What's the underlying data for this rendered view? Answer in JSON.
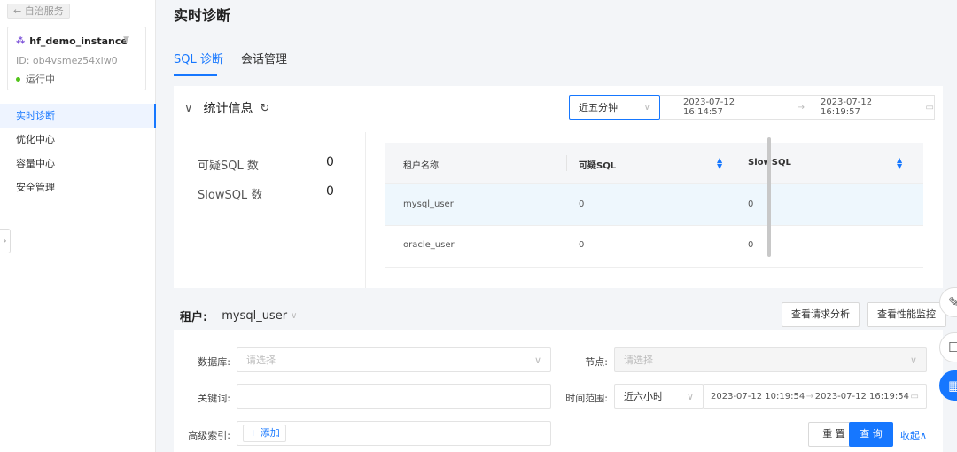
{
  "sidebar": {
    "back_label": "← 自治服务",
    "instance": {
      "name": "hf_demo_instance",
      "id": "ID: ob4vsmez54xiw0",
      "status": "运行中"
    },
    "menu": [
      {
        "label": "实时诊断",
        "active": true
      },
      {
        "label": "优化中心",
        "active": false
      },
      {
        "label": "容量中心",
        "active": false
      },
      {
        "label": "安全管理",
        "active": false
      }
    ]
  },
  "page": {
    "title": "实时诊断"
  },
  "tabs": [
    {
      "label": "SQL 诊断",
      "active": true
    },
    {
      "label": "会话管理",
      "active": false
    }
  ],
  "stats": {
    "title": "统计信息",
    "time_select": "近五分钟",
    "range_from": "2023-07-12 16:14:57",
    "range_to": "2023-07-12 16:19:57",
    "items": [
      {
        "label": "可疑SQL 数",
        "value": "0"
      },
      {
        "label": "SlowSQL 数",
        "value": "0"
      }
    ],
    "table": {
      "headers": [
        "租户名称",
        "可疑SQL",
        "SlowSQL"
      ],
      "rows": [
        {
          "tenant": "mysql_user",
          "suspicious": "0",
          "slow": "0"
        },
        {
          "tenant": "oracle_user",
          "suspicious": "0",
          "slow": "0"
        }
      ]
    }
  },
  "tenant_bar": {
    "label": "租户:",
    "value": "mysql_user",
    "request_btn": "查看请求分析",
    "perf_btn": "查看性能监控"
  },
  "filters": {
    "db_label": "数据库:",
    "db_placeholder": "请选择",
    "node_label": "节点:",
    "node_placeholder": "请选择",
    "keyword_label": "关键词:",
    "time_label": "时间范围:",
    "time_select": "近六小时",
    "time_from": "2023-07-12 10:19:54",
    "time_to": "2023-07-12 16:19:54",
    "adv_label": "高级索引:",
    "add_label": "+ 添加",
    "reset_btn": "重 置",
    "query_btn": "查 询",
    "collapse_link": "收起∧"
  },
  "colors": {
    "accent": "#1677ff",
    "status_running": "#52c41a"
  }
}
